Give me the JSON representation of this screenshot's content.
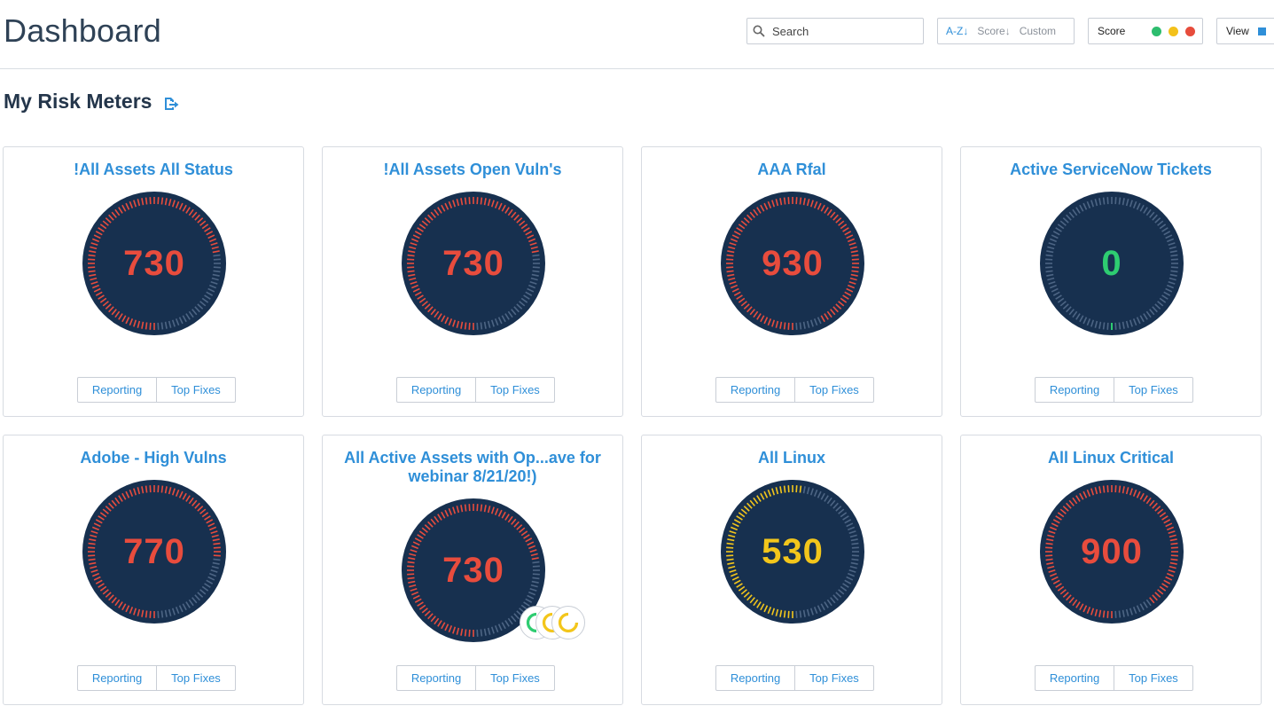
{
  "header": {
    "title": "Dashboard",
    "search_placeholder": "Search",
    "sort": {
      "az": "A-Z",
      "score": "Score",
      "custom": "Custom"
    },
    "score_filter_label": "Score",
    "score_colors": [
      "#2dbd6e",
      "#f3c11b",
      "#e74c3c"
    ],
    "view_label": "View"
  },
  "section": {
    "title": "My Risk Meters"
  },
  "buttons": {
    "reporting": "Reporting",
    "top_fixes": "Top Fixes"
  },
  "colors": {
    "navy": "#17304f",
    "red": "#e84c3d",
    "yellow": "#f3c61b",
    "green": "#2ecc71",
    "track": "#4d6584",
    "accent": "#2f8fd8"
  },
  "meters": [
    {
      "title": "!All Assets All Status",
      "score": "730",
      "fraction": 0.73,
      "color": "red"
    },
    {
      "title": "!All Assets Open Vuln's",
      "score": "730",
      "fraction": 0.73,
      "color": "red"
    },
    {
      "title": "AAA Rfal",
      "score": "930",
      "fraction": 0.93,
      "color": "red"
    },
    {
      "title": "Active ServiceNow Tickets",
      "score": "0",
      "fraction": 0.0,
      "color": "green"
    },
    {
      "title": "Adobe - High Vulns",
      "score": "770",
      "fraction": 0.77,
      "color": "red"
    },
    {
      "title": "All Active Assets with Op...ave for webinar 8/21/20!)",
      "score": "730",
      "fraction": 0.73,
      "color": "red"
    },
    {
      "title": "All Linux",
      "score": "530",
      "fraction": 0.53,
      "color": "yellow"
    },
    {
      "title": "All Linux Critical",
      "score": "900",
      "fraction": 0.9,
      "color": "red"
    }
  ]
}
